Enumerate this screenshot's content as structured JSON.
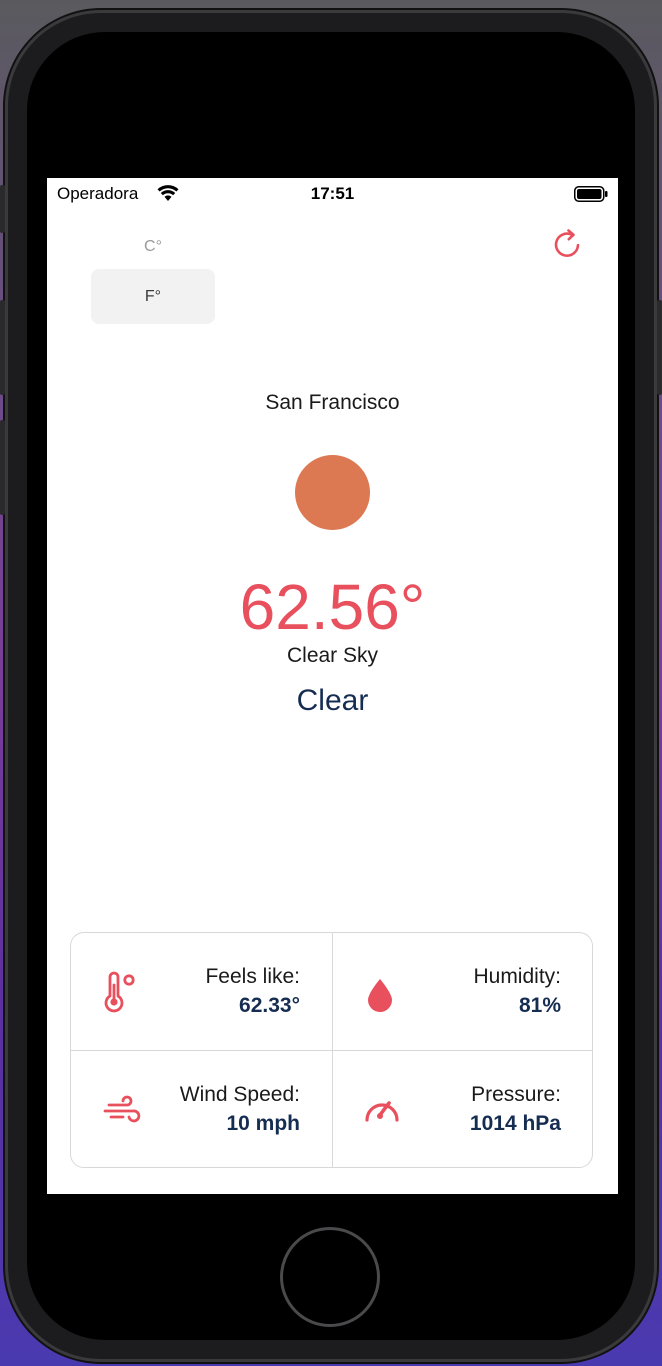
{
  "status_bar": {
    "carrier": "Operadora",
    "time": "17:51"
  },
  "units": {
    "celsius": "C°",
    "fahrenheit": "F°",
    "selected": "F°"
  },
  "weather": {
    "city": "San Francisco",
    "temperature": "62.56°",
    "description": "Clear Sky",
    "condition": "Clear"
  },
  "details": [
    {
      "label": "Feels like:",
      "value": "62.33°",
      "icon": "thermometer-icon"
    },
    {
      "label": "Humidity:",
      "value": "81%",
      "icon": "droplet-icon"
    },
    {
      "label": "Wind Speed:",
      "value": "10 mph",
      "icon": "wind-icon"
    },
    {
      "label": "Pressure:",
      "value": "1014 hPa",
      "icon": "gauge-icon"
    }
  ],
  "colors": {
    "accent": "#e8505e",
    "sun": "#dc7852",
    "navy": "#162d52"
  }
}
